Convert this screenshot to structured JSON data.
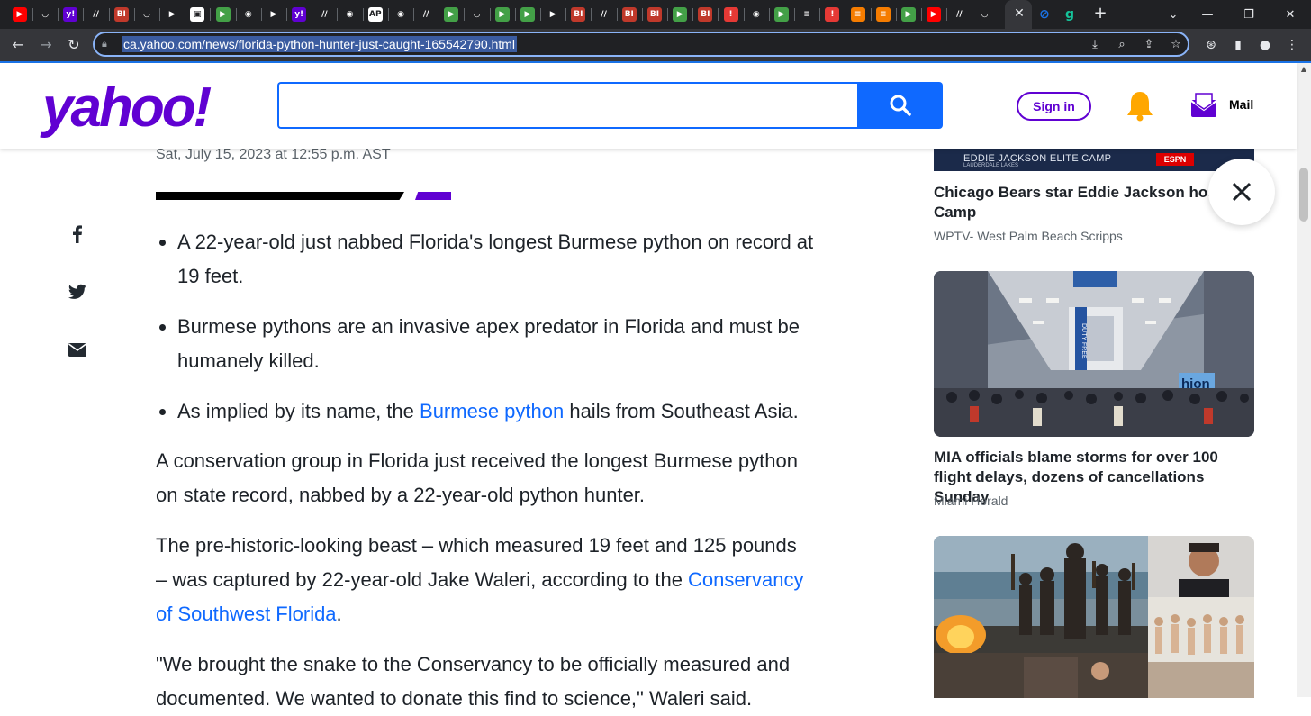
{
  "browser": {
    "tab_favicons": [
      {
        "name": "youtube-icon",
        "color": "#ff0000",
        "glyph": "▶"
      },
      {
        "name": "shield-icon",
        "color": "#202124",
        "glyph": "◡"
      },
      {
        "name": "yahoo-favicon-icon",
        "color": "#6001d2",
        "glyph": "y!"
      },
      {
        "name": "slash-icon",
        "color": "#202124",
        "glyph": "//"
      },
      {
        "name": "business-insider-icon",
        "color": "#c0392b",
        "glyph": "BI"
      },
      {
        "name": "shield-icon",
        "color": "#202124",
        "glyph": "◡"
      },
      {
        "name": "flag-icon",
        "color": "#202124",
        "glyph": "▶"
      },
      {
        "name": "image-icon",
        "color": "#ffffff",
        "glyph": "▣"
      },
      {
        "name": "play-icon",
        "color": "#43a047",
        "glyph": "▶"
      },
      {
        "name": "globe-icon",
        "color": "#202124",
        "glyph": "◉"
      },
      {
        "name": "flag-icon",
        "color": "#202124",
        "glyph": "▶"
      },
      {
        "name": "yahoo-favicon-icon",
        "color": "#6001d2",
        "glyph": "y!"
      },
      {
        "name": "slash-icon",
        "color": "#202124",
        "glyph": "//"
      },
      {
        "name": "globe-icon",
        "color": "#202124",
        "glyph": "◉"
      },
      {
        "name": "ap-icon",
        "color": "#ffffff",
        "glyph": "AP"
      },
      {
        "name": "globe-icon",
        "color": "#202124",
        "glyph": "◉"
      },
      {
        "name": "slash-icon",
        "color": "#202124",
        "glyph": "//"
      },
      {
        "name": "play-icon",
        "color": "#43a047",
        "glyph": "▶"
      },
      {
        "name": "shield-icon",
        "color": "#202124",
        "glyph": "◡"
      },
      {
        "name": "play-icon",
        "color": "#43a047",
        "glyph": "▶"
      },
      {
        "name": "play-icon",
        "color": "#43a047",
        "glyph": "▶"
      },
      {
        "name": "flag-icon",
        "color": "#202124",
        "glyph": "▶"
      },
      {
        "name": "business-insider-icon",
        "color": "#c0392b",
        "glyph": "BI"
      },
      {
        "name": "slash-icon",
        "color": "#202124",
        "glyph": "//"
      },
      {
        "name": "business-insider-icon",
        "color": "#c0392b",
        "glyph": "BI"
      },
      {
        "name": "business-insider-icon",
        "color": "#c0392b",
        "glyph": "BI"
      },
      {
        "name": "play-icon",
        "color": "#43a047",
        "glyph": "▶"
      },
      {
        "name": "business-insider-icon",
        "color": "#c0392b",
        "glyph": "BI"
      },
      {
        "name": "pin-icon",
        "color": "#e53935",
        "glyph": "!"
      },
      {
        "name": "globe-icon",
        "color": "#202124",
        "glyph": "◉"
      },
      {
        "name": "play-icon",
        "color": "#43a047",
        "glyph": "▶"
      },
      {
        "name": "news-icon",
        "color": "#202124",
        "glyph": "≡"
      },
      {
        "name": "pin-icon",
        "color": "#e53935",
        "glyph": "!"
      },
      {
        "name": "bookmark-icon",
        "color": "#f57c00",
        "glyph": "≡"
      },
      {
        "name": "bookmark-icon",
        "color": "#f57c00",
        "glyph": "≡"
      },
      {
        "name": "play-icon",
        "color": "#43a047",
        "glyph": "▶"
      },
      {
        "name": "youtube-icon",
        "color": "#ff0000",
        "glyph": "▶"
      },
      {
        "name": "slash-icon",
        "color": "#202124",
        "glyph": "//"
      },
      {
        "name": "shield-icon",
        "color": "#202124",
        "glyph": "◡"
      }
    ],
    "active_tab_close": "✕",
    "after_tabs": [
      {
        "name": "link-icon",
        "color": "#1a73e8",
        "glyph": "⊘"
      },
      {
        "name": "grammarly-icon",
        "color": "#15c39a",
        "glyph": "g"
      }
    ],
    "new_tab": "+",
    "window_controls": {
      "dropdown": "⌄",
      "minimize": "—",
      "maximize": "❐",
      "close": "✕"
    },
    "nav": {
      "back": "←",
      "forward": "→",
      "reload": "↻"
    },
    "url": "ca.yahoo.com/news/florida-python-hunter-just-caught-165542790.html"
  },
  "header": {
    "logo_text": "yahoo!",
    "search_placeholder": "",
    "signin_label": "Sign in",
    "mail_label": "Mail"
  },
  "article": {
    "date": "Sat, July 15, 2023 at 12:55 p.m. AST",
    "bullets": [
      {
        "text": "A 22-year-old just nabbed Florida's longest Burmese python on record at 19 feet."
      },
      {
        "text": "Burmese pythons are an invasive apex predator in Florida and must be humanely killed."
      },
      {
        "pre": "As implied by its name, the ",
        "link": "Burmese python",
        "post": " hails from Southeast Asia."
      }
    ],
    "para1": "A conservation group in Florida just received the longest Burmese python on state record, nabbed by a 22-year-old python hunter.",
    "para2_pre": "The pre-historic-looking beast – which measured 19 feet and 125 pounds – was captured by 22-year-old Jake Waleri, according to the ",
    "para2_link": "Conservancy of Southwest Florida",
    "para2_post": ".",
    "para3": "\"We brought the snake to the Conservancy to be officially measured and documented. We wanted to donate this find to science,\" Waleri said."
  },
  "sidebar": {
    "card1": {
      "image_caption": "EDDIE JACKSON ELITE CAMP",
      "image_subcaption": "LAUDERDALE LAKES",
      "image_badge": "ESPN",
      "title": "Chicago Bears star Eddie Jackson host Elite Camp",
      "source": "WPTV- West Palm Beach Scripps"
    },
    "card2": {
      "title": "MIA officials blame storms for over 100 flight delays, dozens of cancellations Sunday",
      "source": "Miami Herald",
      "sign_text": "DUTY FREE",
      "store_sign": "hion"
    }
  },
  "colors": {
    "yahoo_purple": "#6001d2",
    "search_blue": "#0f69ff",
    "link_blue": "#0f69ff",
    "text": "#1d2228",
    "muted": "#5b636a"
  }
}
